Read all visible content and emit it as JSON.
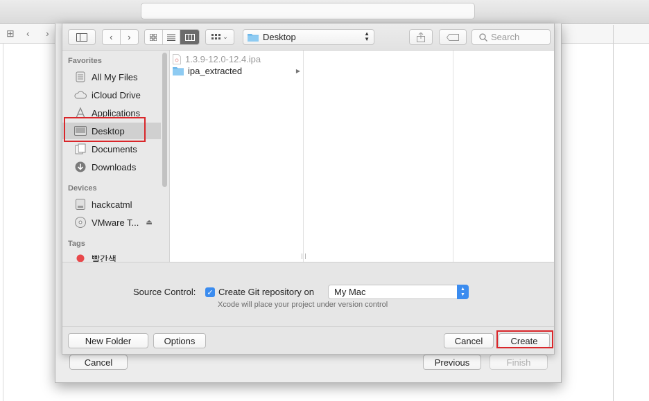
{
  "save_panel": {
    "location": "Desktop",
    "search_placeholder": "Search",
    "sidebar": {
      "favorites_header": "Favorites",
      "favorites": [
        {
          "label": "All My Files",
          "icon": "all-files-icon"
        },
        {
          "label": "iCloud Drive",
          "icon": "cloud-icon"
        },
        {
          "label": "Applications",
          "icon": "applications-icon"
        },
        {
          "label": "Desktop",
          "icon": "desktop-icon",
          "selected": true
        },
        {
          "label": "Documents",
          "icon": "documents-icon"
        },
        {
          "label": "Downloads",
          "icon": "downloads-icon"
        }
      ],
      "devices_header": "Devices",
      "devices": [
        {
          "label": "hackcatml",
          "icon": "disk-icon"
        },
        {
          "label": "VMware T...",
          "icon": "optical-disc-icon"
        }
      ],
      "tags_header": "Tags",
      "tags": [
        {
          "label": "빨간색",
          "color": "#e8484b"
        }
      ]
    },
    "files": [
      {
        "name": "1.3.9-12.0-12.4.ipa",
        "type": "file",
        "dimmed": true
      },
      {
        "name": "ipa_extracted",
        "type": "folder",
        "dimmed": false
      }
    ],
    "source_control": {
      "label": "Source Control:",
      "checkbox_label": "Create Git repository on",
      "checked": true,
      "target": "My Mac",
      "hint": "Xcode will place your project under version control"
    },
    "buttons": {
      "new_folder": "New Folder",
      "options": "Options",
      "cancel": "Cancel",
      "create": "Create"
    }
  },
  "assistant": {
    "cancel": "Cancel",
    "previous": "Previous",
    "finish": "Finish"
  },
  "colors": {
    "accent": "#3b8cef",
    "highlight_box": "#d9262a",
    "tag_red": "#e8484b",
    "folder": "#6cb7ea"
  }
}
